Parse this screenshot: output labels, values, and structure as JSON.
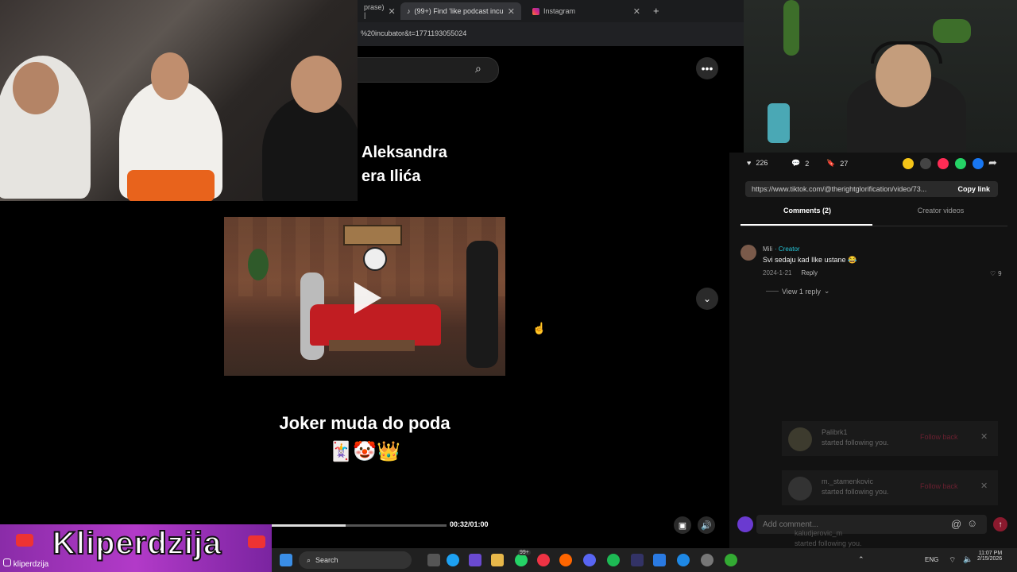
{
  "browser": {
    "tabs": [
      {
        "label": "prase) |",
        "active": false
      },
      {
        "label": "(99+) Find 'like podcast incubat",
        "active": true
      },
      {
        "label": "Instagram",
        "active": false
      }
    ],
    "new_tab": "+",
    "address": "%20incubator&t=1771193055024"
  },
  "tiktok": {
    "caption_line1": "Aleksandra",
    "caption_line2": "era Ilića",
    "video_title": "Joker muda do poda",
    "video_emoji": "🃏🤡👑",
    "time": "00:32/01:00",
    "progress": 0.53
  },
  "stats": {
    "likes": "226",
    "comments": "2",
    "saves": "27"
  },
  "share": {
    "link": "https://www.tiktok.com/@therightglorification/video/73...",
    "copy_label": "Copy link"
  },
  "panel_tabs": {
    "comments": "Comments (2)",
    "creator": "Creator videos"
  },
  "comment": {
    "user": "Mili",
    "creator_tag": "· Creator",
    "text": "Svi sedaju kad Ilke ustane 😂",
    "date": "2024-1-21",
    "reply": "Reply",
    "likes": "9",
    "view_replies": "View 1 reply"
  },
  "notifications": [
    {
      "user": "Palibrk1",
      "text": "started following you.",
      "action": "Follow back"
    },
    {
      "user": "m._stamenkovic",
      "text": "started following you.",
      "action": "Follow back"
    },
    {
      "user": "kaludjerovic_m",
      "text": "started following you.",
      "action": ""
    }
  ],
  "comment_input": {
    "placeholder": "Add comment..."
  },
  "branding": {
    "name": "Kliperdzija",
    "handle": "kliperdzija"
  },
  "taskbar": {
    "search": "Search",
    "badge": "99+",
    "lang": "ENG",
    "time": "11:07 PM",
    "date": "2/15/2026"
  },
  "colors": {
    "tiktok_accent": "#fe2c55",
    "creator_tag": "#25c4d6",
    "brand_purple": "#b23ac8"
  }
}
